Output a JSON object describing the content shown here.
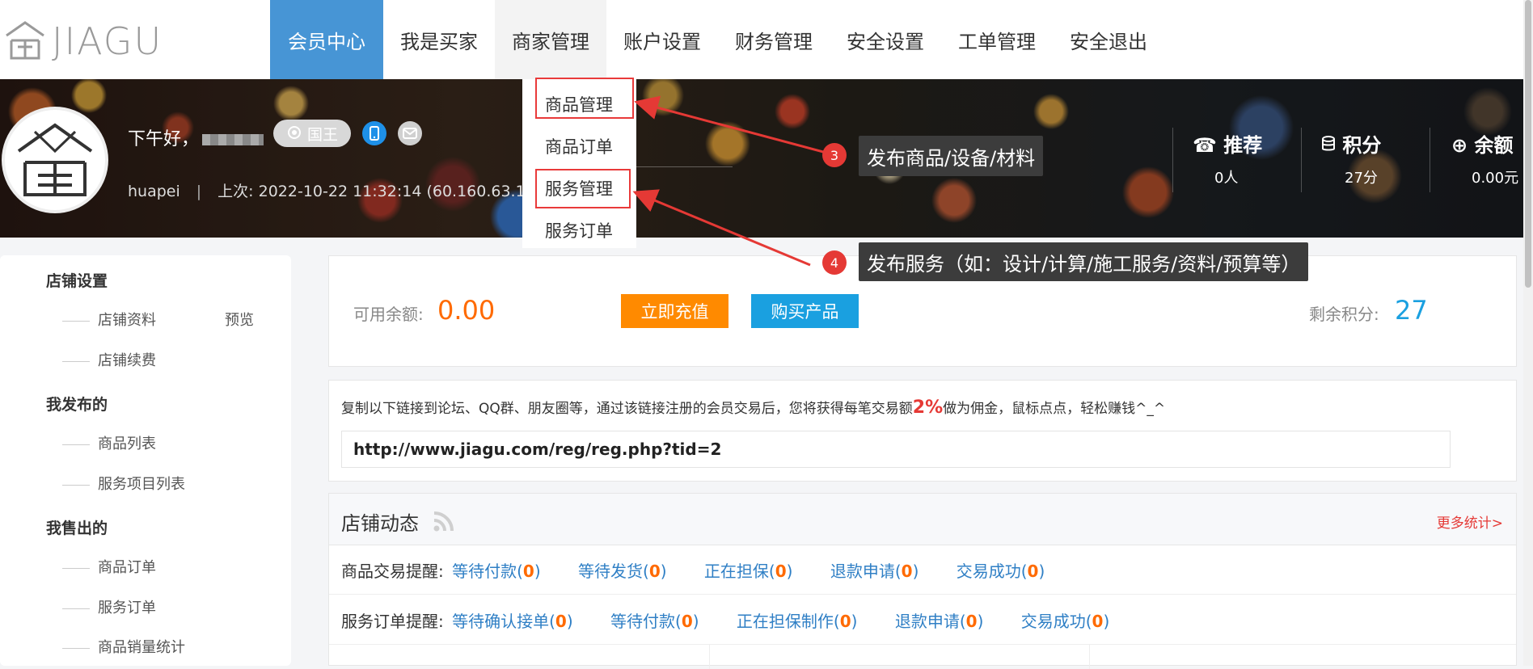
{
  "logo": {
    "text": "JIAGU"
  },
  "nav": {
    "items": [
      "会员中心",
      "我是买家",
      "商家管理",
      "账户设置",
      "财务管理",
      "安全设置",
      "工单管理",
      "安全退出"
    ]
  },
  "dropdown": {
    "items": [
      "商品管理",
      "商品订单",
      "服务管理",
      "服务订单"
    ]
  },
  "banner": {
    "greeting": "下午好，",
    "level_badge": "国王",
    "username": "huapei",
    "last_login": "上次: 2022-10-22 11:32:14 (60.160.63.10)",
    "stats": [
      {
        "icon": "phone-icon",
        "title": "推荐",
        "value": "0人"
      },
      {
        "icon": "database-icon",
        "title": "积分",
        "value": "27分"
      },
      {
        "icon": "yen-icon",
        "title": "余额",
        "value": "0.00元"
      }
    ]
  },
  "callouts": [
    {
      "number": "3",
      "text": "发布商品/设备/材料"
    },
    {
      "number": "4",
      "text": "发布服务（如：设计/计算/施工服务/资料/预算等）"
    }
  ],
  "sidebar": {
    "groups": [
      {
        "title": "店铺设置",
        "items": [
          "店铺资料",
          "店铺续费"
        ],
        "preview": "预览"
      },
      {
        "title": "我发布的",
        "items": [
          "商品列表",
          "服务项目列表"
        ]
      },
      {
        "title": "我售出的",
        "items": [
          "商品订单",
          "服务订单",
          "商品销量统计"
        ]
      }
    ]
  },
  "balance": {
    "label": "可用余额:",
    "value": "0.00",
    "recharge_button": "立即充值",
    "buy_button": "购买产品",
    "points_label": "剩余积分:",
    "points_value": "27"
  },
  "referral": {
    "text_before": "复制以下链接到论坛、QQ群、朋友圈等，通过该链接注册的会员交易后，您将获得每笔交易额",
    "percent": "2%",
    "text_after": "做为佣金，鼠标点点，轻松赚钱^_^",
    "link": "http://www.jiagu.com/reg/reg.php?tid=2"
  },
  "activity": {
    "title": "店铺动态",
    "more": "更多统计>",
    "goods_label": "商品交易提醒:",
    "goods": [
      {
        "label": "等待付款",
        "count": "0"
      },
      {
        "label": "等待发货",
        "count": "0"
      },
      {
        "label": "正在担保",
        "count": "0"
      },
      {
        "label": "退款申请",
        "count": "0"
      },
      {
        "label": "交易成功",
        "count": "0"
      }
    ],
    "service_label": "服务订单提醒:",
    "services": [
      {
        "label": "等待确认接单",
        "count": "0"
      },
      {
        "label": "等待付款",
        "count": "0"
      },
      {
        "label": "正在担保制作",
        "count": "0"
      },
      {
        "label": "退款申请",
        "count": "0"
      },
      {
        "label": "交易成功",
        "count": "0"
      }
    ]
  },
  "colors": {
    "nav_active": "#4795d5",
    "orange": "#ff8a00",
    "blue": "#1aa0e0",
    "accent_red": "#e53935"
  }
}
